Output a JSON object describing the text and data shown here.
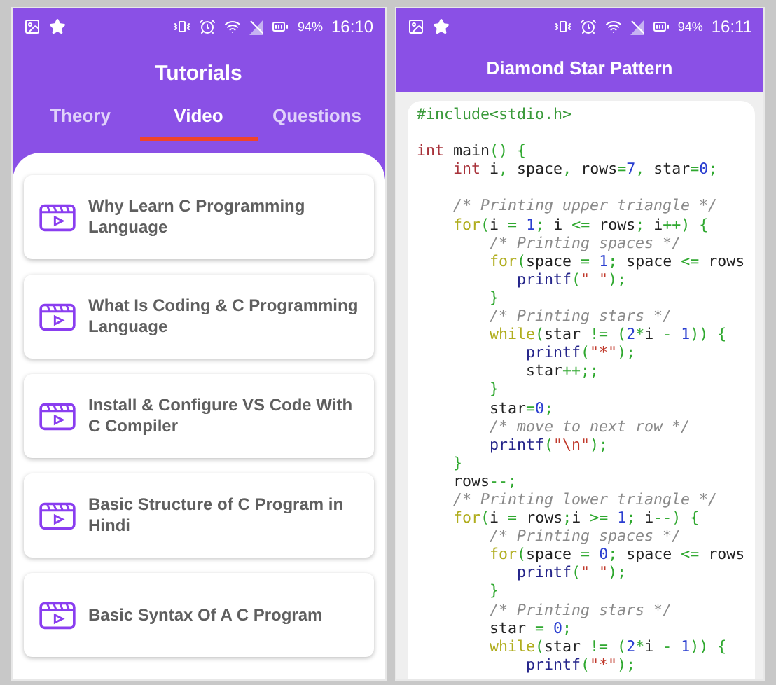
{
  "tutorials_screen": {
    "status_bar": {
      "battery": "94%",
      "time": "16:10"
    },
    "title": "Tutorials",
    "tabs": [
      {
        "label": "Theory",
        "selected": false
      },
      {
        "label": "Video",
        "selected": true
      },
      {
        "label": "Questions",
        "selected": false
      }
    ],
    "videos": [
      {
        "title": "Why Learn C Programming Language"
      },
      {
        "title": "What Is Coding & C Programming Language"
      },
      {
        "title": "Install & Configure VS Code With C Compiler"
      },
      {
        "title": "Basic Structure of C Program in Hindi"
      },
      {
        "title": "Basic Syntax Of A C Program"
      }
    ]
  },
  "code_screen": {
    "status_bar": {
      "battery": "94%",
      "time": "16:11"
    },
    "title": "Diamond Star Pattern",
    "code_lines": [
      {
        "kind": "code",
        "tokens": [
          {
            "kind": "preprocessor",
            "t": "#include<stdio.h>"
          }
        ]
      },
      {
        "kind": "blank"
      },
      {
        "kind": "code",
        "tokens": [
          {
            "kind": "type",
            "t": "int"
          },
          {
            "kind": "plain",
            "t": " main"
          },
          {
            "kind": "punct",
            "t": "() {"
          }
        ]
      },
      {
        "kind": "code",
        "tokens": [
          {
            "kind": "type",
            "t": "    int"
          },
          {
            "kind": "plain",
            "t": " i"
          },
          {
            "kind": "punct",
            "t": ","
          },
          {
            "kind": "plain",
            "t": " space"
          },
          {
            "kind": "punct",
            "t": ","
          },
          {
            "kind": "plain",
            "t": " rows"
          },
          {
            "kind": "punct",
            "t": "="
          },
          {
            "kind": "number",
            "t": "7"
          },
          {
            "kind": "punct",
            "t": ","
          },
          {
            "kind": "plain",
            "t": " star"
          },
          {
            "kind": "punct",
            "t": "="
          },
          {
            "kind": "number",
            "t": "0"
          },
          {
            "kind": "punct",
            "t": ";"
          }
        ]
      },
      {
        "kind": "blank"
      },
      {
        "kind": "code",
        "tokens": [
          {
            "kind": "comment",
            "t": "    /* Printing upper triangle */"
          }
        ]
      },
      {
        "kind": "code",
        "tokens": [
          {
            "kind": "keyword",
            "t": "    for"
          },
          {
            "kind": "punct",
            "t": "("
          },
          {
            "kind": "plain",
            "t": "i "
          },
          {
            "kind": "punct",
            "t": "="
          },
          {
            "kind": "number",
            "t": " 1"
          },
          {
            "kind": "punct",
            "t": ";"
          },
          {
            "kind": "plain",
            "t": " i "
          },
          {
            "kind": "punct",
            "t": "<="
          },
          {
            "kind": "plain",
            "t": " rows"
          },
          {
            "kind": "punct",
            "t": ";"
          },
          {
            "kind": "plain",
            "t": " i"
          },
          {
            "kind": "punct",
            "t": "++) {"
          }
        ]
      },
      {
        "kind": "code",
        "tokens": [
          {
            "kind": "comment",
            "t": "        /* Printing spaces */"
          }
        ]
      },
      {
        "kind": "code",
        "tokens": [
          {
            "kind": "keyword",
            "t": "        for"
          },
          {
            "kind": "punct",
            "t": "("
          },
          {
            "kind": "plain",
            "t": "space "
          },
          {
            "kind": "punct",
            "t": "="
          },
          {
            "kind": "number",
            "t": " 1"
          },
          {
            "kind": "punct",
            "t": ";"
          },
          {
            "kind": "plain",
            "t": " space "
          },
          {
            "kind": "punct",
            "t": "<="
          },
          {
            "kind": "plain",
            "t": " rows"
          }
        ]
      },
      {
        "kind": "code",
        "tokens": [
          {
            "kind": "function",
            "t": "           printf"
          },
          {
            "kind": "punct",
            "t": "("
          },
          {
            "kind": "string",
            "t": "\" \""
          },
          {
            "kind": "punct",
            "t": ");"
          }
        ]
      },
      {
        "kind": "code",
        "tokens": [
          {
            "kind": "punct",
            "t": "        }"
          }
        ]
      },
      {
        "kind": "code",
        "tokens": [
          {
            "kind": "comment",
            "t": "        /* Printing stars */"
          }
        ]
      },
      {
        "kind": "code",
        "tokens": [
          {
            "kind": "keyword",
            "t": "        while"
          },
          {
            "kind": "punct",
            "t": "("
          },
          {
            "kind": "plain",
            "t": "star "
          },
          {
            "kind": "punct",
            "t": "!= ("
          },
          {
            "kind": "number",
            "t": "2"
          },
          {
            "kind": "punct",
            "t": "*"
          },
          {
            "kind": "plain",
            "t": "i "
          },
          {
            "kind": "punct",
            "t": "-"
          },
          {
            "kind": "number",
            "t": " 1"
          },
          {
            "kind": "punct",
            "t": ")) {"
          }
        ]
      },
      {
        "kind": "code",
        "tokens": [
          {
            "kind": "function",
            "t": "            printf"
          },
          {
            "kind": "punct",
            "t": "("
          },
          {
            "kind": "string",
            "t": "\"*\""
          },
          {
            "kind": "punct",
            "t": ");"
          }
        ]
      },
      {
        "kind": "code",
        "tokens": [
          {
            "kind": "plain",
            "t": "            star"
          },
          {
            "kind": "punct",
            "t": "++;;"
          }
        ]
      },
      {
        "kind": "code",
        "tokens": [
          {
            "kind": "punct",
            "t": "        }"
          }
        ]
      },
      {
        "kind": "code",
        "tokens": [
          {
            "kind": "plain",
            "t": "        star"
          },
          {
            "kind": "punct",
            "t": "="
          },
          {
            "kind": "number",
            "t": "0"
          },
          {
            "kind": "punct",
            "t": ";"
          }
        ]
      },
      {
        "kind": "code",
        "tokens": [
          {
            "kind": "comment",
            "t": "        /* move to next row */"
          }
        ]
      },
      {
        "kind": "code",
        "tokens": [
          {
            "kind": "function",
            "t": "        printf"
          },
          {
            "kind": "punct",
            "t": "("
          },
          {
            "kind": "string",
            "t": "\"\\n\""
          },
          {
            "kind": "punct",
            "t": ");"
          }
        ]
      },
      {
        "kind": "code",
        "tokens": [
          {
            "kind": "punct",
            "t": "    }"
          }
        ]
      },
      {
        "kind": "code",
        "tokens": [
          {
            "kind": "plain",
            "t": "    rows"
          },
          {
            "kind": "punct",
            "t": "--;"
          }
        ]
      },
      {
        "kind": "code",
        "tokens": [
          {
            "kind": "comment",
            "t": "    /* Printing lower triangle */"
          }
        ]
      },
      {
        "kind": "code",
        "tokens": [
          {
            "kind": "keyword",
            "t": "    for"
          },
          {
            "kind": "punct",
            "t": "("
          },
          {
            "kind": "plain",
            "t": "i "
          },
          {
            "kind": "punct",
            "t": "="
          },
          {
            "kind": "plain",
            "t": " rows"
          },
          {
            "kind": "punct",
            "t": ";"
          },
          {
            "kind": "plain",
            "t": "i "
          },
          {
            "kind": "punct",
            "t": ">="
          },
          {
            "kind": "number",
            "t": " 1"
          },
          {
            "kind": "punct",
            "t": ";"
          },
          {
            "kind": "plain",
            "t": " i"
          },
          {
            "kind": "punct",
            "t": "--) {"
          }
        ]
      },
      {
        "kind": "code",
        "tokens": [
          {
            "kind": "comment",
            "t": "        /* Printing spaces */"
          }
        ]
      },
      {
        "kind": "code",
        "tokens": [
          {
            "kind": "keyword",
            "t": "        for"
          },
          {
            "kind": "punct",
            "t": "("
          },
          {
            "kind": "plain",
            "t": "space "
          },
          {
            "kind": "punct",
            "t": "="
          },
          {
            "kind": "number",
            "t": " 0"
          },
          {
            "kind": "punct",
            "t": ";"
          },
          {
            "kind": "plain",
            "t": " space "
          },
          {
            "kind": "punct",
            "t": "<="
          },
          {
            "kind": "plain",
            "t": " rows"
          }
        ]
      },
      {
        "kind": "code",
        "tokens": [
          {
            "kind": "function",
            "t": "           printf"
          },
          {
            "kind": "punct",
            "t": "("
          },
          {
            "kind": "string",
            "t": "\" \""
          },
          {
            "kind": "punct",
            "t": ");"
          }
        ]
      },
      {
        "kind": "code",
        "tokens": [
          {
            "kind": "punct",
            "t": "        }"
          }
        ]
      },
      {
        "kind": "code",
        "tokens": [
          {
            "kind": "comment",
            "t": "        /* Printing stars */"
          }
        ]
      },
      {
        "kind": "code",
        "tokens": [
          {
            "kind": "plain",
            "t": "        star "
          },
          {
            "kind": "punct",
            "t": "="
          },
          {
            "kind": "number",
            "t": " 0"
          },
          {
            "kind": "punct",
            "t": ";"
          }
        ]
      },
      {
        "kind": "code",
        "tokens": [
          {
            "kind": "keyword",
            "t": "        while"
          },
          {
            "kind": "punct",
            "t": "("
          },
          {
            "kind": "plain",
            "t": "star "
          },
          {
            "kind": "punct",
            "t": "!= ("
          },
          {
            "kind": "number",
            "t": "2"
          },
          {
            "kind": "punct",
            "t": "*"
          },
          {
            "kind": "plain",
            "t": "i "
          },
          {
            "kind": "punct",
            "t": "-"
          },
          {
            "kind": "number",
            "t": " 1"
          },
          {
            "kind": "punct",
            "t": ")) {"
          }
        ]
      },
      {
        "kind": "code",
        "tokens": [
          {
            "kind": "function",
            "t": "            printf"
          },
          {
            "kind": "punct",
            "t": "("
          },
          {
            "kind": "string",
            "t": "\"*\""
          },
          {
            "kind": "punct",
            "t": ");"
          }
        ]
      }
    ]
  }
}
